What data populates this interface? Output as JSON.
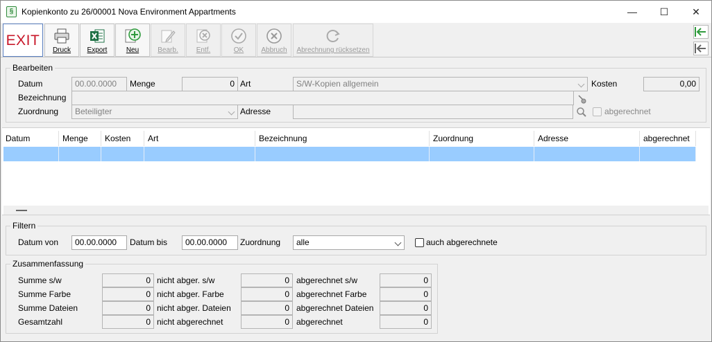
{
  "window": {
    "title": "Kopienkonto zu 26/00001 Nova Environment Appartments",
    "app_icon": "§",
    "controls": {
      "minimize": "—",
      "maximize": "☐",
      "close": "✕"
    }
  },
  "toolbar": {
    "exit_label": "EXIT",
    "buttons": [
      {
        "label": "Druck",
        "icon": "printer-icon"
      },
      {
        "label": "Export",
        "icon": "excel-icon"
      },
      {
        "label": "Neu",
        "icon": "plus-icon"
      },
      {
        "label": "Bearb.",
        "icon": "pencil-icon"
      },
      {
        "label": "Entf.",
        "icon": "delete-icon"
      },
      {
        "label": "OK",
        "icon": "check-icon"
      },
      {
        "label": "Abbruch",
        "icon": "cancel-icon"
      },
      {
        "label": "Abrechnung rücksetzen",
        "icon": "refresh-icon"
      }
    ]
  },
  "bearbeiten": {
    "title": "Bearbeiten",
    "datum_label": "Datum",
    "datum_value": "00.00.0000",
    "menge_label": "Menge",
    "menge_value": "0",
    "art_label": "Art",
    "art_value": "S/W-Kopien allgemein",
    "kosten_label": "Kosten",
    "kosten_value": "0,00",
    "bezeichnung_label": "Bezeichnung",
    "bezeichnung_value": "",
    "zuordnung_label": "Zuordnung",
    "zuordnung_value": "Beteiligter",
    "adresse_label": "Adresse",
    "adresse_value": "",
    "abgerechnet_label": "abgerechnet"
  },
  "grid": {
    "columns": [
      "Datum",
      "Menge",
      "Kosten",
      "Art",
      "Bezeichnung",
      "Zuordnung",
      "Adresse",
      "abgerechnet"
    ],
    "rows": [
      [
        "",
        "",
        "",
        "",
        "",
        "",
        "",
        ""
      ]
    ]
  },
  "filtern": {
    "title": "Filtern",
    "datum_von_label": "Datum von",
    "datum_von_value": "00.00.0000",
    "datum_bis_label": "Datum bis",
    "datum_bis_value": "00.00.0000",
    "zuordnung_label": "Zuordnung",
    "zuordnung_value": "alle",
    "auch_label": "auch abgerechnete"
  },
  "zusammenfassung": {
    "title": "Zusammenfassung",
    "rows": [
      {
        "l1": "Summe s/w",
        "v1": "0",
        "l2": "nicht abger. s/w",
        "v2": "0",
        "l3": "abgerechnet s/w",
        "v3": "0"
      },
      {
        "l1": "Summe Farbe",
        "v1": "0",
        "l2": "nicht abger. Farbe",
        "v2": "0",
        "l3": "abgerechnet Farbe",
        "v3": "0"
      },
      {
        "l1": "Summe Dateien",
        "v1": "0",
        "l2": "nicht abger. Dateien",
        "v2": "0",
        "l3": "abgerechnet Dateien",
        "v3": "0"
      },
      {
        "l1": "Gesamtzahl",
        "v1": "0",
        "l2": "nicht abgerechnet",
        "v2": "0",
        "l3": "abgerechnet",
        "v3": "0"
      }
    ]
  }
}
